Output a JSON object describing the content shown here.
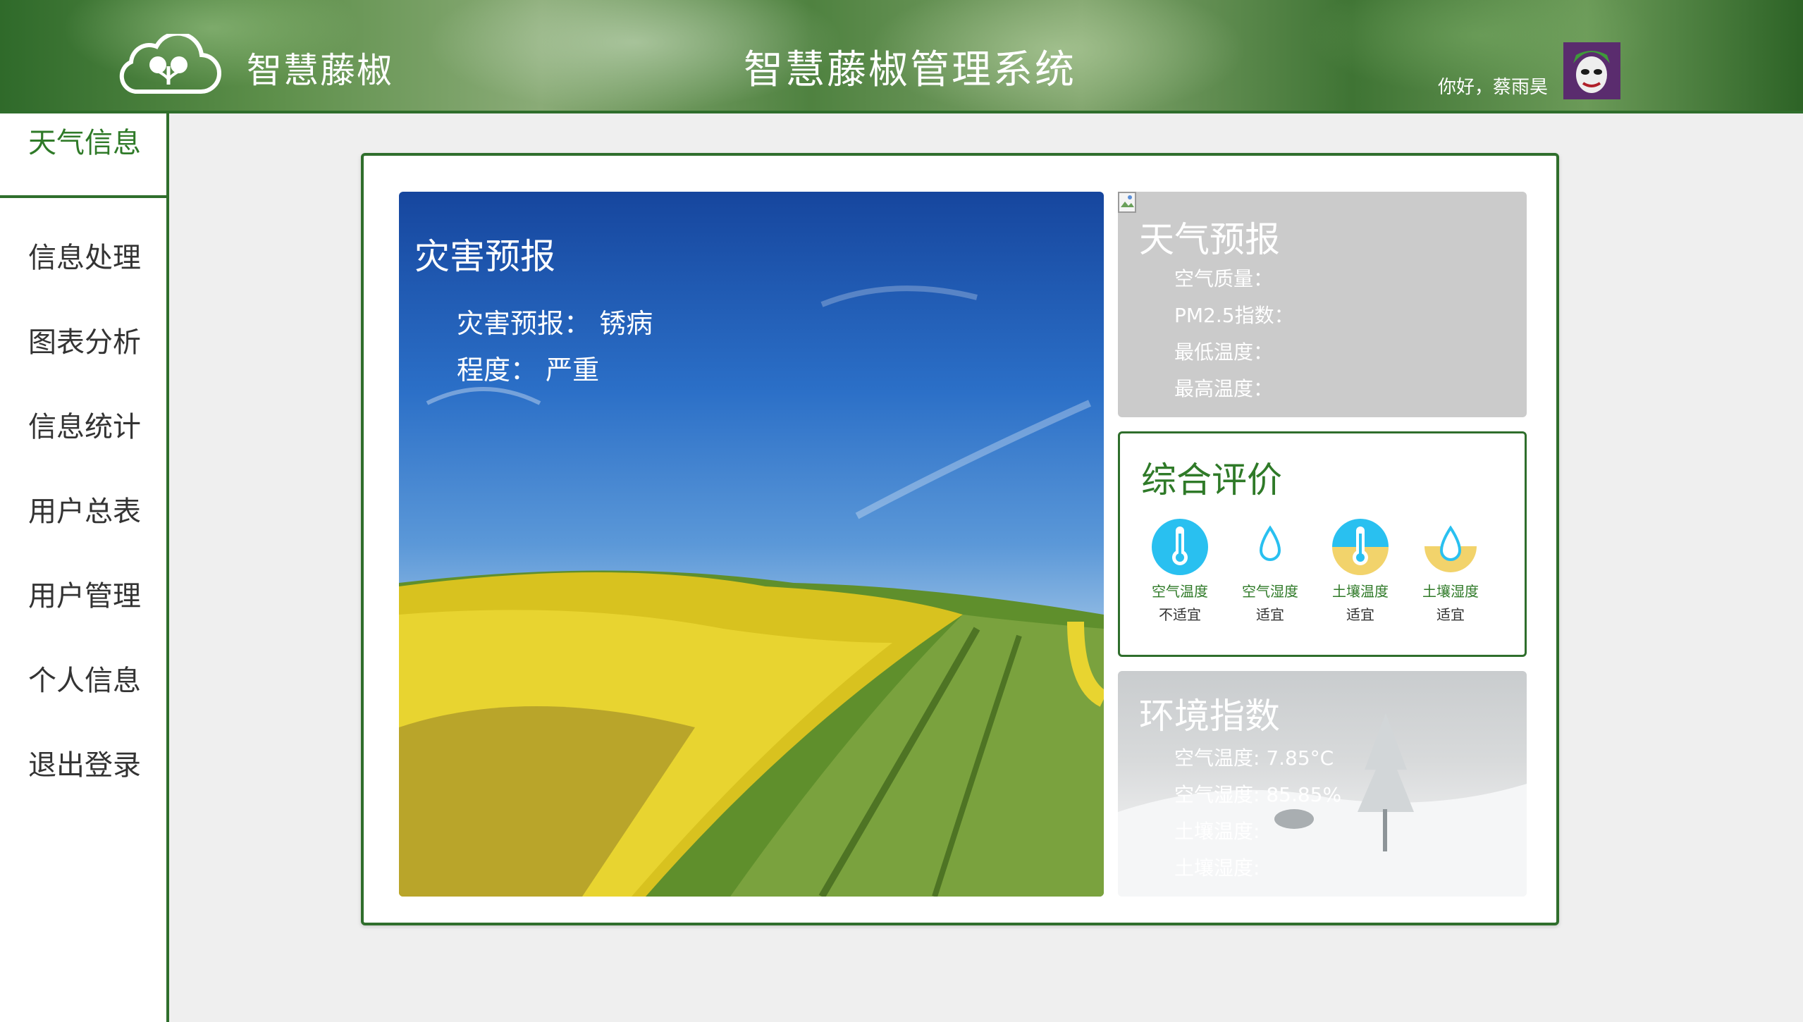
{
  "header": {
    "brand": "智慧藤椒",
    "title": "智慧藤椒管理系统",
    "greeting": "你好，蔡雨昊",
    "logo_icon": "cloud-sprout-icon",
    "avatar_icon": "joker-avatar"
  },
  "sidebar": {
    "items": [
      {
        "label": "天气信息",
        "active": true
      },
      {
        "label": "信息处理"
      },
      {
        "label": "图表分析"
      },
      {
        "label": "信息统计"
      },
      {
        "label": "用户总表"
      },
      {
        "label": "用户管理"
      },
      {
        "label": "个人信息"
      },
      {
        "label": "退出登录"
      }
    ]
  },
  "disaster": {
    "title": "灾害预报",
    "forecast_label": "灾害预报：",
    "forecast_value": "锈病",
    "severity_label": "程度：",
    "severity_value": "严重"
  },
  "weather": {
    "title": "天气预报",
    "air_quality_label": "空气质量：",
    "pm25_label": "PM2.5指数：",
    "min_temp_label": "最低温度：",
    "max_temp_label": "最高温度："
  },
  "evaluation": {
    "title": "综合评价",
    "indicators": [
      {
        "name": "空气温度",
        "status": "不适宜",
        "icon": "thermometer-icon"
      },
      {
        "name": "空气湿度",
        "status": "适宜",
        "icon": "water-drop-icon"
      },
      {
        "name": "土壤温度",
        "status": "适宜",
        "icon": "thermometer-icon"
      },
      {
        "name": "土壤湿度",
        "status": "适宜",
        "icon": "water-drop-icon"
      }
    ]
  },
  "environment": {
    "title": "环境指数",
    "air_temp": "空气温度: 7.85°C",
    "air_humidity": "空气湿度: 85.85%",
    "soil_temp": "土壤温度:",
    "soil_humidity": "土壤湿度:"
  },
  "colors": {
    "primary_green": "#2f6e2c",
    "active_text": "#2f7a28",
    "indicator_blue": "#29c0f0",
    "indicator_yellow": "#f2d36b"
  }
}
